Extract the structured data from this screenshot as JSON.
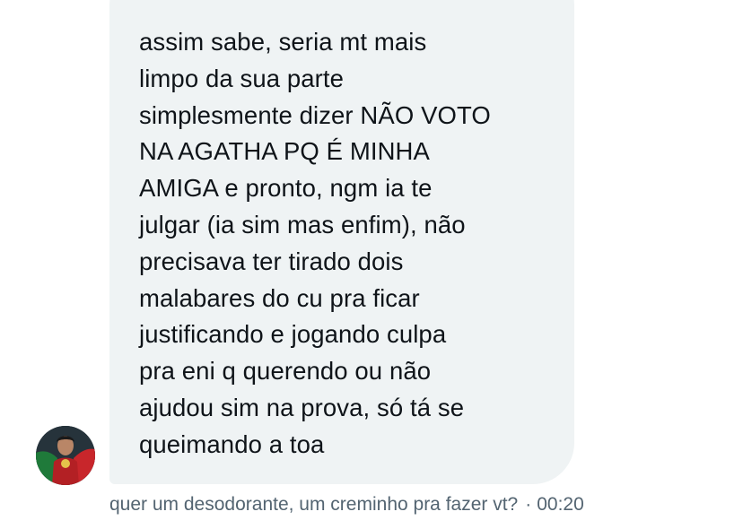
{
  "message": {
    "text": "assim sabe, seria mt mais\nlimpo da sua parte\nsimplesmente dizer NÃO VOTO\nNA AGATHA PQ É MINHA\nAMIGA e pronto, ngm ia te\njulgar (ia sim mas enfim), não\nprecisava ter tirado dois\nmalabares do cu pra ficar\njustificando e jogando culpa\npra eni q querendo ou não\najudou sim na prova, só tá se\nqueimando a toa",
    "bubble_color": "#eff3f4"
  },
  "sender": {
    "avatar_icon": "user-avatar-flag"
  },
  "meta": {
    "caption": "quer um desodorante, um creminho pra fazer vt?",
    "separator": "·",
    "time": "00:20"
  },
  "colors": {
    "text": "#0f1419",
    "meta": "#536471",
    "background": "#ffffff"
  }
}
